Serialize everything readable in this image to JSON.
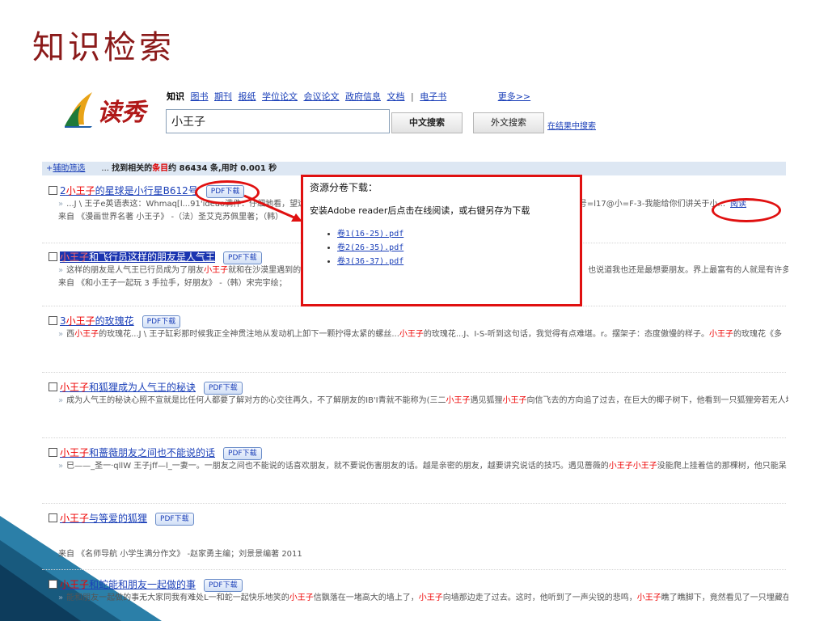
{
  "slide": {
    "title": "知识检索"
  },
  "brand": {
    "logo_text": "读秀",
    "accent": "#b01818"
  },
  "search": {
    "categories": [
      {
        "label": "知识",
        "active": true
      },
      {
        "label": "图书"
      },
      {
        "label": "期刊"
      },
      {
        "label": "报纸"
      },
      {
        "label": "学位论文"
      },
      {
        "label": "会议论文"
      },
      {
        "label": "政府信息"
      },
      {
        "label": "文档"
      },
      {
        "label": "电子书"
      }
    ],
    "separator": "|",
    "more_label": "更多>>",
    "query": "小王子",
    "search_cn_label": "中文搜索",
    "search_en_label": "外文搜索",
    "in_results_label": "在结果中搜索"
  },
  "stats": {
    "plus": "+",
    "filter_label": "辅助筛选",
    "ellipsis": "...",
    "found_prefix": "找到相关的",
    "found_red": "条目",
    "found_suffix": "约 86434 条,用时 0.001 秒"
  },
  "results": [
    {
      "title_pre": "2",
      "title_hl": "小王子",
      "title_post": "的星球是小行星B612号",
      "pdf_label": "PDF下载",
      "snippet_parts": [
        "...J \\ 王子e英语表这：Whmaq[l...91'ideao满件：仔细地看，望远"
      ],
      "snippet_tail": "12号=l17@小=F-3-我能给你们讲关于小...",
      "read_label": "阅读",
      "source": "来自 《漫画世界名著 小王子》 -（法）圣艾克苏佩里著；（韩）"
    },
    {
      "title_pre": "",
      "title_hl": "小王子",
      "title_post": "和飞行员这样的朋友是人气王",
      "pdf_label": "PDF下载",
      "snippet_parts": [
        "这样的朋友是人气王已行员成为了朋友",
        "小王子",
        "就和在沙漠里遇到的"
      ],
      "snippet_tail": "也说道我也还是最想要朋友。界上最富有的人就是有许多朋",
      "source": "来自 《和小王子一起玩 3 手拉手，好朋友》 -（韩）宋完宇绘；"
    },
    {
      "title_pre": "3",
      "title_hl": "小王子",
      "title_post": "的玫瑰花",
      "pdf_label": "PDF下载",
      "snippet_parts": [
        "西",
        "小王子",
        "的玫瑰花...J \\ 王子缸彩那时候我正全神贯注地从发动机上卸下一颗拧得太紧的螺丝...",
        "小王子",
        "的玫瑰花...J、I-S-听到这句话，我觉得有点难堪。r。摆架子：态度傲慢的样子。",
        "小王子",
        "的玫瑰花《多"
      ]
    },
    {
      "title_pre": "",
      "title_hl": "小王子",
      "title_post": "和狐狸成为人气王的秘诀",
      "pdf_label": "PDF下载",
      "snippet_parts": [
        "成为人气王的秘诀心照不宣就是比任何人都要了解对方的心交往再久，不了解朋友的IB'I青就不能称为(三二",
        "小王子",
        "遇见狐狸",
        "小王子",
        "向信飞去的方向追了过去，在巨大的椰子树下，他看到一只狐狸旁若无人地"
      ]
    },
    {
      "title_pre": "",
      "title_hl": "小王子",
      "title_post": "和蔷薇朋友之间也不能说的话",
      "pdf_label": "PDF下载",
      "snippet_parts": [
        "巳——_圣一·qllW 王子jff—l_一妻一。一朋友之间也不能说的话喜欢朋友，就不要说伤害朋友的话。越是亲密的朋友，越要讲究说话的技巧。遇见蔷薇的",
        "小王子小王子",
        "没能爬上挂着信的那棵树，他只能呆"
      ]
    },
    {
      "title_pre": "",
      "title_hl": "小王子",
      "title_post": "与等爱的狐狸",
      "pdf_label": "PDF下载",
      "source": "来自 《名师导航 小学生满分作文》 -赵家勇主编；刘景景编著 2011"
    },
    {
      "title_pre": "",
      "title_hl": "小王子",
      "title_post": "和蛇能和朋友一起做的事",
      "pdf_label": "PDF下载",
      "snippet_parts": [
        "能和朋友一起做的事无大家同我有难处L一和蛇一起快乐地笑的",
        "小王子",
        "信飘落在一堵高大的墙上了，",
        "小王子",
        "向墙那边走了过去。这时，他听到了一声尖锐的悲鸣，",
        "小王子",
        "瞧了瞧脚下，竟然看见了一只埋藏在"
      ]
    }
  ],
  "popup": {
    "title": "资源分卷下载：",
    "instruction": "安装Adobe reader后点击在线阅读，或右键另存为下载",
    "files": [
      "卷1(16-25).pdf",
      "卷2(26-35).pdf",
      "卷3(36-37).pdf"
    ]
  },
  "colors": {
    "highlight": "#e00000",
    "link": "#1a3fb8",
    "annotation": "#e01010"
  }
}
